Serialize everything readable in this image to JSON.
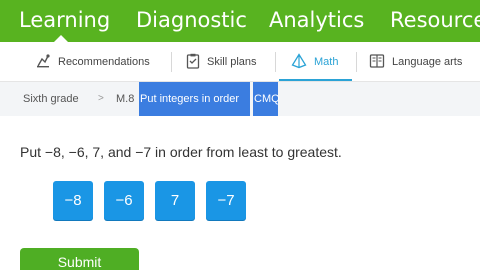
{
  "top_nav": {
    "items": [
      {
        "label": "Learning",
        "active": true
      },
      {
        "label": "Diagnostic"
      },
      {
        "label": "Analytics"
      },
      {
        "label": "Resources"
      }
    ]
  },
  "sub_nav": {
    "tabs": [
      {
        "label": "Recommendations",
        "icon": "recommendations-icon"
      },
      {
        "label": "Skill plans",
        "icon": "skill-plans-icon"
      },
      {
        "label": "Math",
        "icon": "math-pyramid-icon",
        "active": true
      },
      {
        "label": "Language arts",
        "icon": "language-arts-book-icon"
      }
    ]
  },
  "breadcrumb": {
    "grade": "Sixth grade",
    "separator": ">",
    "skill_code": "M.8",
    "skill_name": "Put integers in order",
    "skill_suffix": "CMQ"
  },
  "question": {
    "prompt": "Put −8, −6, 7, and −7 in order from least to greatest."
  },
  "tiles": [
    "−8",
    "−6",
    "7",
    "−7"
  ],
  "submit_label": "Submit",
  "colors": {
    "header_green": "#58b320",
    "tile_blue": "#1a96e5",
    "active_tab_blue": "#2ba3d6",
    "highlight_blue": "#3b7de0",
    "submit_green": "#4fae24"
  }
}
